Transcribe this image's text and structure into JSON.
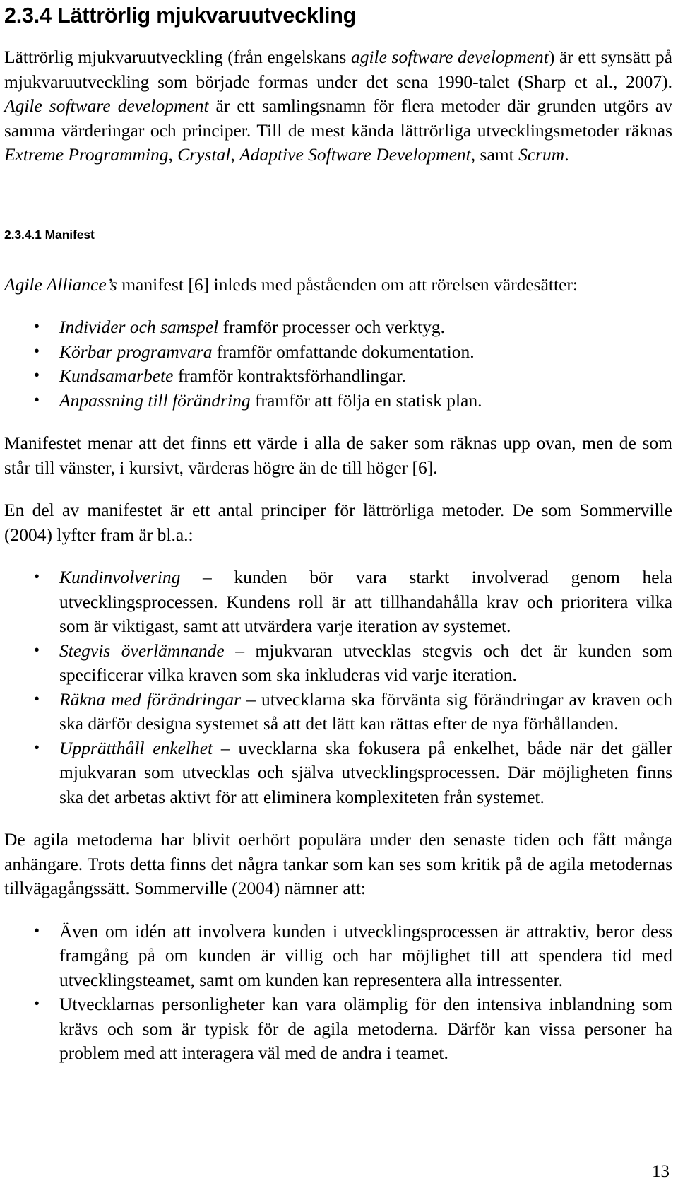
{
  "document": {
    "language": "sv",
    "page_number": "13"
  },
  "headings": {
    "section_number": "2.3.4",
    "section_title": "Lättrörlig mjukvaruutveckling",
    "section_full": "2.3.4 Lättrörlig mjukvaruutveckling",
    "subsection_full": "2.3.4.1 Manifest"
  },
  "paragraphs": {
    "intro_1": "Lättrörlig mjukvaruutveckling (från engelskans ",
    "intro_1_it1": "agile software development",
    "intro_2": ") är ett synsätt på mjukvaruutveckling som började formas under det sena 1990-talet (Sharp et al., 2007). ",
    "intro_it2": "Agile software development",
    "intro_3": " är ett samlingsnamn för flera metoder där grunden utgörs av samma värderingar och principer. Till de mest kända lättrörliga utvecklingsmetoder räknas ",
    "intro_it3": "Extreme Programming",
    "intro_4": ", ",
    "intro_it4": "Crystal",
    "intro_5": ", ",
    "intro_it5": "Adaptive Software Development",
    "intro_6": ", samt ",
    "intro_it6": "Scrum",
    "intro_7": ".",
    "manifest_lead_it": "Agile Alliance’s",
    "manifest_lead_rest": " manifest [6] inleds med påståenden om att rörelsen värdesätter:",
    "manifest_note": "Manifestet menar att det finns ett värde i alla de saker som räknas upp ovan, men de som står till vänster, i kursivt, värderas högre än de till höger [6].",
    "principles_lead": "En del av manifestet är ett antal principer för lättrörliga metoder. De som Sommerville (2004) lyfter fram är bl.a.:",
    "critique_lead": "De agila metoderna har blivit oerhört populära under den senaste tiden och fått många anhängare. Trots detta finns det några tankar som kan ses som kritik på de agila metodernas tillvägagångssätt. Sommerville (2004) nämner att:"
  },
  "manifest_values": [
    {
      "italic": "Individer och samspel",
      "rest": " framför processer och verktyg."
    },
    {
      "italic": "Körbar programvara",
      "rest": " framför omfattande dokumentation."
    },
    {
      "italic": "Kundsamarbete",
      "rest": " framför kontraktsförhandlingar."
    },
    {
      "italic": "Anpassning till förändring",
      "rest": " framför att följa en statisk plan."
    }
  ],
  "principles": [
    {
      "italic": "Kundinvolvering",
      "rest": " – kunden bör vara starkt involverad genom hela utvecklingsprocessen. Kundens roll är att tillhandahålla krav och prioritera vilka som är viktigast, samt att utvärdera varje iteration av systemet."
    },
    {
      "italic": "Stegvis överlämnande",
      "rest": " – mjukvaran utvecklas stegvis och det är kunden som specificerar vilka kraven som ska inkluderas vid varje iteration."
    },
    {
      "italic": "Räkna med förändringar",
      "rest": " – utvecklarna ska förvänta sig förändringar av kraven och ska därför designa systemet så att det lätt kan rättas efter de nya förhållanden."
    },
    {
      "italic": "Upprätthåll enkelhet",
      "rest": " – uvecklarna ska fokusera på enkelhet, både när det gäller mjukvaran som utvecklas och själva utvecklingsprocessen. Där möjligheten finns ska det arbetas aktivt för att eliminera komplexiteten från systemet."
    }
  ],
  "critique_points": [
    {
      "text": "Även om idén att involvera kunden i utvecklingsprocessen är attraktiv, beror dess framgång på om kunden är villig och har möjlighet till att spendera tid med utvecklingsteamet, samt om kunden kan representera alla intressenter."
    },
    {
      "text": "Utvecklarnas personligheter kan vara olämplig för den intensiva inblandning som krävs och som är typisk för de agila metoderna. Därför kan vissa personer ha problem med att interagera väl med de andra i teamet."
    }
  ]
}
